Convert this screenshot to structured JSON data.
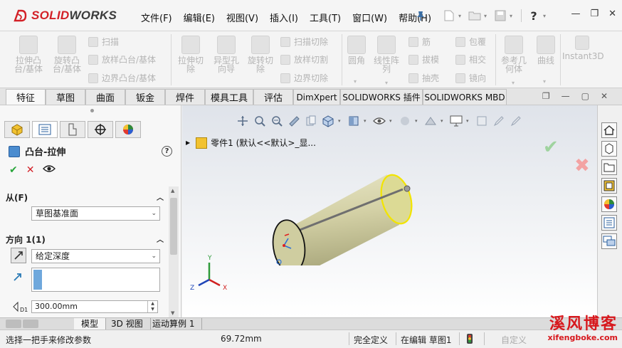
{
  "app": {
    "brand_prefix": "SOLID",
    "brand_suffix": "WORKS",
    "menus": [
      "文件(F)",
      "编辑(E)",
      "视图(V)",
      "插入(I)",
      "工具(T)",
      "窗口(W)",
      "帮助(H)"
    ]
  },
  "toolbar": {
    "extrude_boss": "拉伸凸\n台/基体",
    "revolve_boss": "旋转凸\n台/基体",
    "sweep": "扫描",
    "loft_boss": "放样凸台/基体",
    "boundary_boss": "边界凸台/基体",
    "extrude_cut": "拉伸切\n除",
    "hole_wizard": "异型孔\n向导",
    "revolve_cut": "旋转切\n除",
    "sweep_cut": "扫描切除",
    "loft_cut": "放样切割",
    "boundary_cut": "边界切除",
    "fillet": "圆角",
    "linear_pattern": "线性阵\n列",
    "rib": "筋",
    "draft": "拔模",
    "shell": "抽壳",
    "wrap": "包覆",
    "intersect": "相交",
    "mirror": "镜向",
    "ref_geometry": "参考几\n何体",
    "curves": "曲线",
    "instant3d": "Instant3D"
  },
  "tabs": [
    "特征",
    "草图",
    "曲面",
    "钣金",
    "焊件",
    "模具工具",
    "评估",
    "DimXpert",
    "SOLIDWORKS 插件",
    "SOLIDWORKS MBD"
  ],
  "property_manager": {
    "title": "凸台-拉伸",
    "from_section": "从(F)",
    "from_value": "草图基准面",
    "direction_section": "方向 1(1)",
    "direction_value": "给定深度",
    "depth_value": "300.00mm",
    "depth_label": "D1"
  },
  "feature_tree": {
    "root": "零件1  (默认<<默认>_显..."
  },
  "triad": {
    "x": "X",
    "y": "Y",
    "z": "Z"
  },
  "bottom_tabs": [
    "模型",
    "3D 视图",
    "运动算例 1"
  ],
  "status": {
    "hint": "选择一把手来修改参数",
    "measure": "69.72mm",
    "definition": "完全定义",
    "editing": "在编辑 草图1",
    "units": "自定义"
  },
  "watermark": {
    "cn": "溪风博客",
    "url": "xifengboke.com"
  },
  "colors": {
    "brand_red": "#d32027",
    "ok_green": "#28a53a",
    "cylinder": "#c9c79a",
    "highlight_yellow": "#f2e400"
  }
}
